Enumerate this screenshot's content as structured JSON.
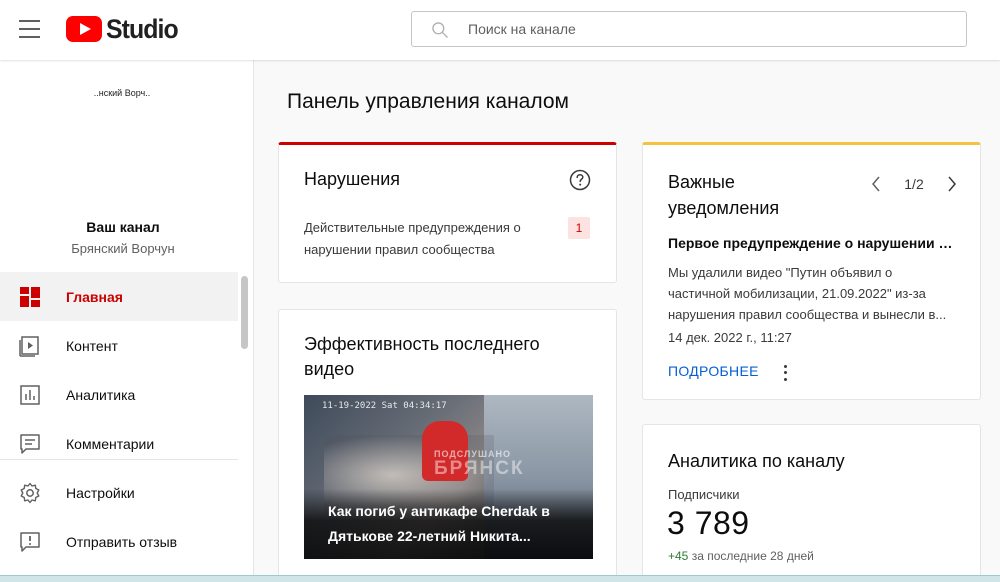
{
  "app": {
    "logo_text": "Studio",
    "search_placeholder": "Поиск на канале"
  },
  "sidebar": {
    "avatar_text": "..нский Ворч..",
    "channel_title": "Ваш канал",
    "channel_name": "Брянский Ворчун",
    "items": [
      {
        "label": "Главная",
        "icon": "dashboard-icon",
        "active": true
      },
      {
        "label": "Контент",
        "icon": "content-icon",
        "active": false
      },
      {
        "label": "Аналитика",
        "icon": "analytics-icon",
        "active": false
      },
      {
        "label": "Комментарии",
        "icon": "comments-icon",
        "active": false
      },
      {
        "label": "Настройки",
        "icon": "settings-icon",
        "active": false
      },
      {
        "label": "Отправить отзыв",
        "icon": "feedback-icon",
        "active": false
      }
    ]
  },
  "main": {
    "page_title": "Панель управления каналом",
    "violations": {
      "title": "Нарушения",
      "text": "Действительные предупреждения о нарушении правил сообщества",
      "count": "1",
      "accent": "#cc0000"
    },
    "last_video": {
      "title": "Эффективность последнего видео",
      "thumb_caption": "Как погиб у антикафе Cherdak в Дятькове 22-летний Никита...",
      "thumb_stamp": "11-19-2022 Sat 04:34:17",
      "thumb_watermark_small": "ПОДСЛУШАНО",
      "thumb_watermark_big": "БРЯНСК"
    },
    "notifications": {
      "title": "Важные уведомления",
      "pager": "1/2",
      "heading": "Первое предупреждение о нарушении правил сообщества",
      "body": "Мы удалили видео \"Путин объявил о частичной мобилизации, 21.09.2022\" из-за нарушения правил сообщества и вынесли в...",
      "date": "14 дек. 2022 г., 11:27",
      "link": "ПОДРОБНЕЕ",
      "accent": "#f5c242"
    },
    "analytics": {
      "title": "Аналитика по каналу",
      "subscribers_label": "Подписчики",
      "subscribers_value": "3 789",
      "delta_value": "+45",
      "delta_text": "за последние 28 дней"
    }
  }
}
